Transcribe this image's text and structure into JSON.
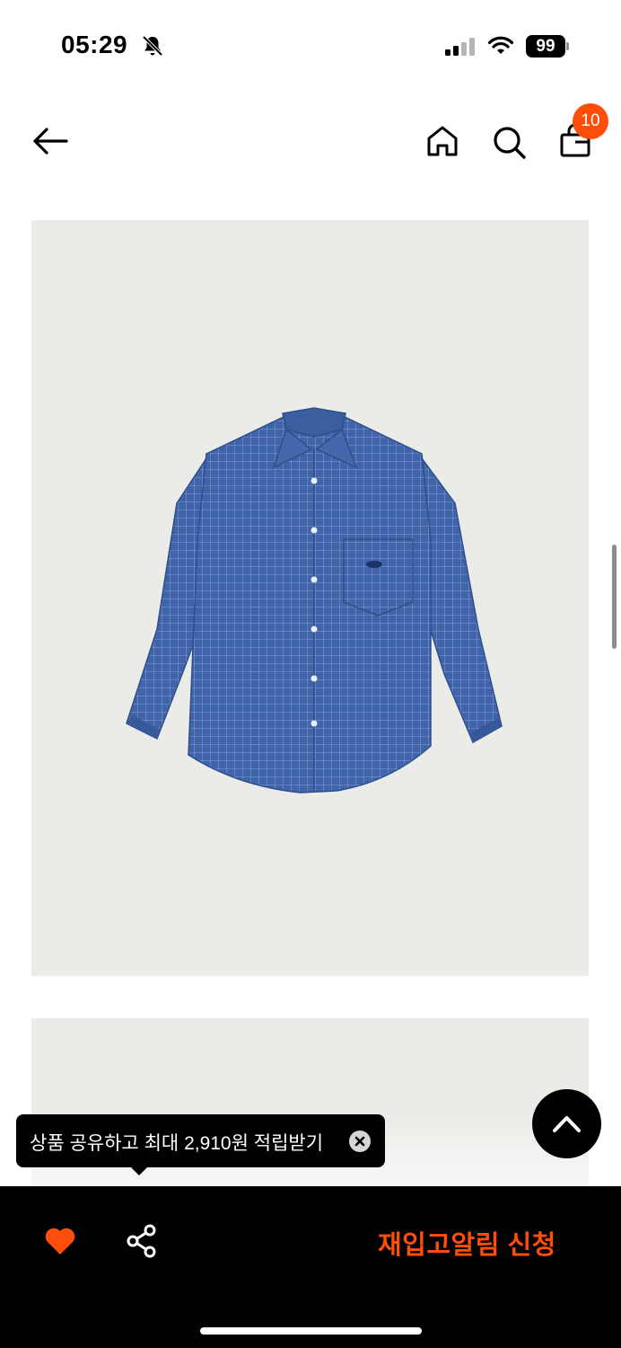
{
  "status_bar": {
    "time": "05:29",
    "battery": "99",
    "icons": [
      "bell-off-icon",
      "cellular-signal-icon",
      "wifi-icon",
      "battery-icon"
    ]
  },
  "header": {
    "icons": [
      "back-arrow-icon",
      "home-icon",
      "search-icon",
      "shopping-bag-icon"
    ],
    "cart_count": "10"
  },
  "product": {
    "images": [
      "blue-check-shirt-front",
      "product-image-2"
    ]
  },
  "tooltip": {
    "text": "상품 공유하고 최대 2,910원 적립받기",
    "close_icon": "close-circle-icon"
  },
  "scroll_top_icon": "chevron-up-icon",
  "bottom_bar": {
    "wishlist_icon": "heart-icon",
    "share_icon": "share-icon",
    "restock_label": "재입고알림 신청"
  },
  "colors": {
    "accent": "#ff4d0a",
    "bar": "#000000",
    "image_bg": "#ebebe8",
    "shirt": "#3d63a8"
  }
}
